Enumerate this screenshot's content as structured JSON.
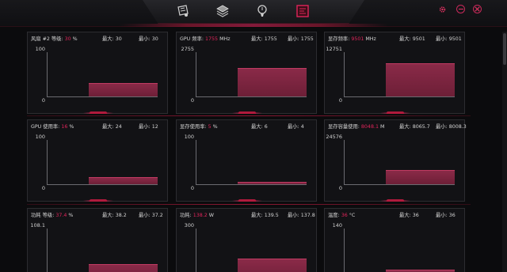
{
  "colors": {
    "accent": "#e0245a",
    "bar": "#7a2440",
    "bg": "#0b0b0d"
  },
  "nav": [
    {
      "name": "monitor-icon"
    },
    {
      "name": "layers-icon"
    },
    {
      "name": "lightbulb-icon"
    },
    {
      "name": "dashboard-icon"
    }
  ],
  "window": {
    "settings": "gear-icon",
    "minimize": "minimize-icon",
    "close": "close-icon"
  },
  "panels": [
    {
      "label": "风扇 #2 等级:",
      "current": "30",
      "unit": "%",
      "max_label": "最大: 30",
      "min_label": "最小: 30",
      "ymax": "100",
      "ymin": "0",
      "level_pct": 30
    },
    {
      "label": "GPU 频率:",
      "current": "1755",
      "unit": "MHz",
      "max_label": "最大: 1755",
      "min_label": "最小: 1755",
      "ymax": "2755",
      "ymin": "0",
      "level_pct": 64
    },
    {
      "label": "显存频率:",
      "current": "9501",
      "unit": "MHz",
      "max_label": "最大: 9501",
      "min_label": "最小: 9501",
      "ymax": "12751",
      "ymin": "0",
      "level_pct": 75
    },
    {
      "label": "GPU 使用率:",
      "current": "16",
      "unit": "%",
      "max_label": "最大: 24",
      "min_label": "最小: 12",
      "ymax": "100",
      "ymin": "0",
      "level_pct": 16
    },
    {
      "label": "显存使用率:",
      "current": "5",
      "unit": "%",
      "max_label": "最大: 6",
      "min_label": "最小: 4",
      "ymax": "100",
      "ymin": "0",
      "level_pct": 5
    },
    {
      "label": "显存容量使用:",
      "current": "8048.1",
      "unit": "M",
      "max_label": "最大: 8065.7",
      "min_label": "最小: 8008.3",
      "ymax": "24576",
      "ymin": "0",
      "level_pct": 33
    },
    {
      "label": "功耗 等级:",
      "current": "37.4",
      "unit": "%",
      "max_label": "最大: 38.2",
      "min_label": "最小: 37.2",
      "ymax": "108.1",
      "ymin": "",
      "level_pct": 35
    },
    {
      "label": "功耗:",
      "current": "138.2",
      "unit": "W",
      "max_label": "最大: 139.5",
      "min_label": "最小: 137.8",
      "ymax": "300",
      "ymin": "",
      "level_pct": 46
    },
    {
      "label": "温度:",
      "current": "36",
      "unit": "°C",
      "max_label": "最大: 36",
      "min_label": "最小: 36",
      "ymax": "140",
      "ymin": "",
      "level_pct": 26
    }
  ]
}
